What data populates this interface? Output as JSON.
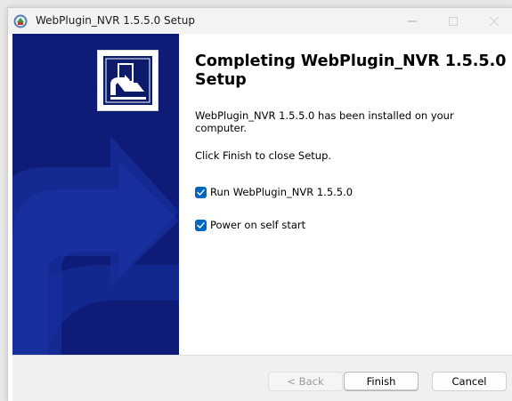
{
  "window": {
    "title": "WebPlugin_NVR 1.5.5.0 Setup",
    "controls": {
      "minimize_icon": "minimize-icon",
      "maximize_icon": "maximize-icon",
      "close_icon": "close-icon"
    }
  },
  "sidebar": {
    "background_color": "#0e1c78",
    "logo_icon": "installer-computer-icon"
  },
  "content": {
    "heading": "Completing WebPlugin_NVR 1.5.5.0 Setup",
    "installed_text": "WebPlugin_NVR 1.5.5.0 has been installed on your computer.",
    "instruction_text": "Click Finish to close Setup.",
    "options": [
      {
        "label": "Run WebPlugin_NVR 1.5.5.0",
        "checked": true
      },
      {
        "label": "Power on self start",
        "checked": true
      }
    ]
  },
  "footer": {
    "back_label": "< Back",
    "finish_label": "Finish",
    "cancel_label": "Cancel"
  },
  "colors": {
    "accent": "#0067c0",
    "sidebar": "#0e1c78"
  }
}
